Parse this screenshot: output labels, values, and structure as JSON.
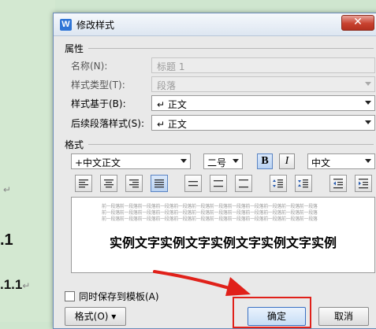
{
  "document": {
    "marks": [
      "↵",
      "↵"
    ],
    "headings": [
      ".1",
      ".1.1"
    ]
  },
  "dialog": {
    "title": "修改样式",
    "close_glyph": "✕",
    "app_icon_letter": "W",
    "properties_label": "属性",
    "name": {
      "label": "名称(N):",
      "value": "标题 1"
    },
    "style_type": {
      "label": "样式类型(T):",
      "value": "段落"
    },
    "based_on": {
      "label": "样式基于(B):",
      "value": "↵ 正文"
    },
    "next_style": {
      "label": "后续段落样式(S):",
      "value": "↵ 正文"
    },
    "format_label": "格式",
    "font": "+中文正文",
    "size": "二号",
    "bold_glyph": "B",
    "italic_glyph": "I",
    "language": "中文",
    "preview_prev_text": "前一段落前一段落前一段落前一段落前一段落前一段落前一段落前一段落前一段落前一段落前一段落前一段落",
    "preview_sample": "实例文字实例文字实例文字实例文字实例",
    "save_to_template": "同时保存到模板(A)",
    "format_button": "格式(O) ▾",
    "ok_button": "确定",
    "cancel_button": "取消"
  },
  "annotation_color": "#e0211a"
}
